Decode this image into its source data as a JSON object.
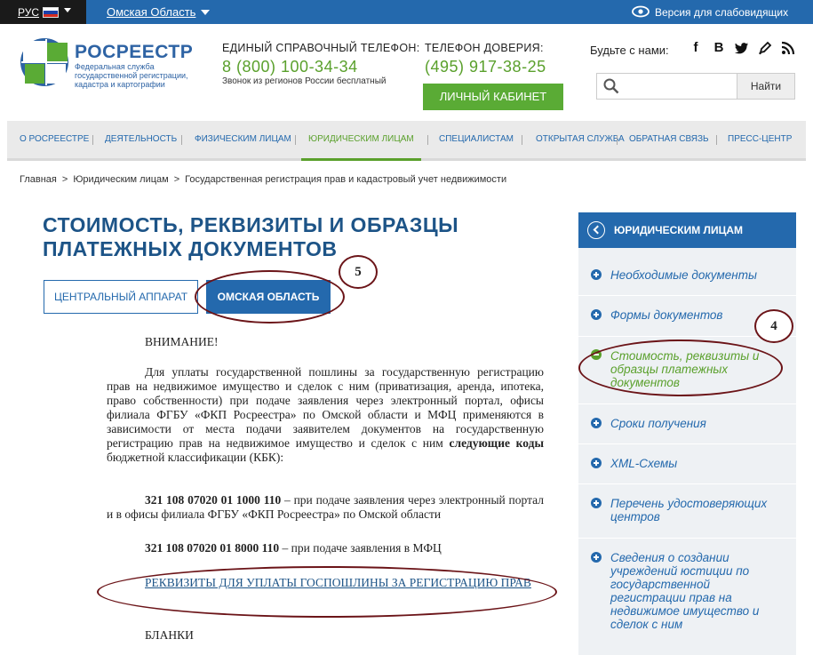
{
  "topbar": {
    "lang": "РУС",
    "region": "Омская Область",
    "blind_version": "Версия для слабовидящих"
  },
  "header": {
    "logo_name": "РОСРЕЕСТР",
    "logo_subtitle": "Федеральная служба государственной регистрации, кадастра и картографии",
    "helpline_label": "ЕДИНЫЙ СПРАВОЧНЫЙ ТЕЛЕФОН:",
    "helpline_number": "8 (800) 100-34-34",
    "helpline_note": "Звонок из регионов России бесплатный",
    "trust_label": "ТЕЛЕФОН ДОВЕРИЯ:",
    "trust_number": "(495) 917-38-25",
    "cabinet_button": "ЛИЧНЫЙ КАБИНЕТ",
    "social_label": "Будьте с нами:",
    "social_icons": [
      "facebook-icon",
      "vk-icon",
      "twitter-icon",
      "blog-icon",
      "rss-icon"
    ],
    "search_placeholder": "",
    "search_button": "Найти"
  },
  "nav": {
    "items": [
      "О РОСРЕЕСТРЕ",
      "ДЕЯТЕЛЬНОСТЬ",
      "ФИЗИЧЕСКИМ ЛИЦАМ",
      "ЮРИДИЧЕСКИМ ЛИЦАМ",
      "СПЕЦИАЛИСТАМ",
      "ОТКРЫТАЯ СЛУЖБА",
      "ОБРАТНАЯ СВЯЗЬ",
      "ПРЕСС-ЦЕНТР"
    ],
    "active_index": 3
  },
  "breadcrumb": [
    "Главная",
    "Юридическим лицам",
    "Государственная регистрация прав и кадастровый учет недвижимости"
  ],
  "main": {
    "title": "СТОИМОСТЬ, РЕКВИЗИТЫ И ОБРАЗЦЫ ПЛАТЕЖНЫХ ДОКУМЕНТОВ",
    "tabs": [
      "ЦЕНТРАЛЬНЫЙ АППАРАТ",
      "ОМСКАЯ ОБЛАСТЬ"
    ],
    "attention": "ВНИМАНИЕ!",
    "para1_before": "Для уплаты государственной пошлины за государственную регистрацию прав на недвижимое имущество и сделок с ним (приватизация, аренда, ипотека, право собственности) при подаче заявления через электронный портал, офисы филиала ФГБУ «ФКП Росреестра» по Омской области и МФЦ применяются в зависимости от места подачи заявителем документов на государственную регистрацию прав на недвижимое имущество и сделок с ним ",
    "para1_bold": "следующие коды",
    "para1_after": " бюджетной классификации (КБК):",
    "code1": "321 108 07020 01 1000 110",
    "code1_text": " – при подаче заявления через электронный портал и в офисы  филиала ФГБУ «ФКП Росреестра» по Омской области",
    "code2": "321 108 07020 01 8000 110",
    "code2_text": " – при подаче заявления в МФЦ",
    "requisites_link": "РЕКВИЗИТЫ ДЛЯ УПЛАТЫ ГОСПОШЛИНЫ ЗА РЕГИСТРАЦИЮ ПРАВ",
    "blanks": "БЛАНКИ"
  },
  "sidebar": {
    "heading": "ЮРИДИЧЕСКИМ ЛИЦАМ",
    "items": [
      "Необходимые документы",
      "Формы документов",
      "Стоимость, реквизиты и образцы платежных документов",
      "Сроки получения",
      "XML-Схемы",
      "Перечень удостоверяющих центров",
      "Сведения о создании учреждений юстиции по государственной регистрации прав на недвижимое имущество и сделок с ним"
    ],
    "active_index": 2
  },
  "annotations": {
    "marker_tab": "5",
    "marker_sidebar": "4"
  },
  "colors": {
    "brand_blue": "#2469ad",
    "accent_green": "#5aa02c",
    "annotation": "#6b1418"
  }
}
